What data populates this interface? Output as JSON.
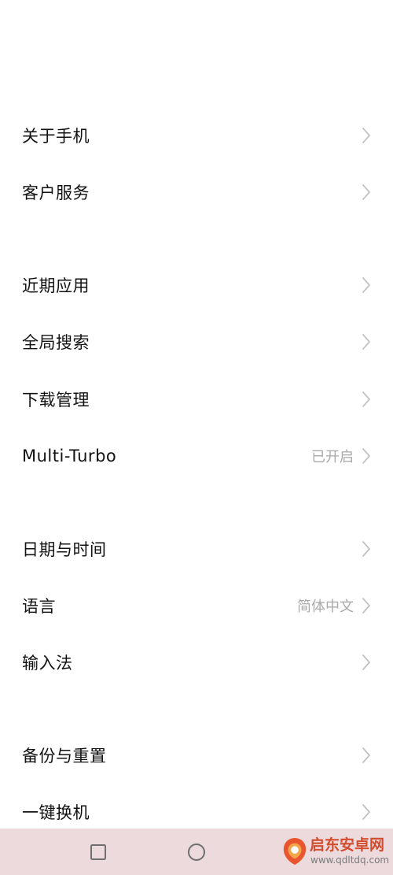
{
  "settings": {
    "items": [
      {
        "label": "关于手机",
        "value": ""
      },
      {
        "label": "客户服务",
        "value": ""
      },
      {
        "label": "近期应用",
        "value": ""
      },
      {
        "label": "全局搜索",
        "value": ""
      },
      {
        "label": "下载管理",
        "value": ""
      },
      {
        "label": "Multi-Turbo",
        "value": "已开启"
      },
      {
        "label": "日期与时间",
        "value": ""
      },
      {
        "label": "语言",
        "value": "简体中文"
      },
      {
        "label": "输入法",
        "value": ""
      },
      {
        "label": "备份与重置",
        "value": ""
      },
      {
        "label": "一键换机",
        "value": ""
      }
    ]
  },
  "nav_bar": {
    "background": "#ecdadd",
    "buttons": [
      {
        "icon": "square-recents-icon"
      },
      {
        "icon": "circle-home-icon"
      }
    ]
  },
  "watermark": {
    "title": "启东安卓网",
    "url": "www.qdltdq.com",
    "accent_color": "#d24d2f"
  }
}
